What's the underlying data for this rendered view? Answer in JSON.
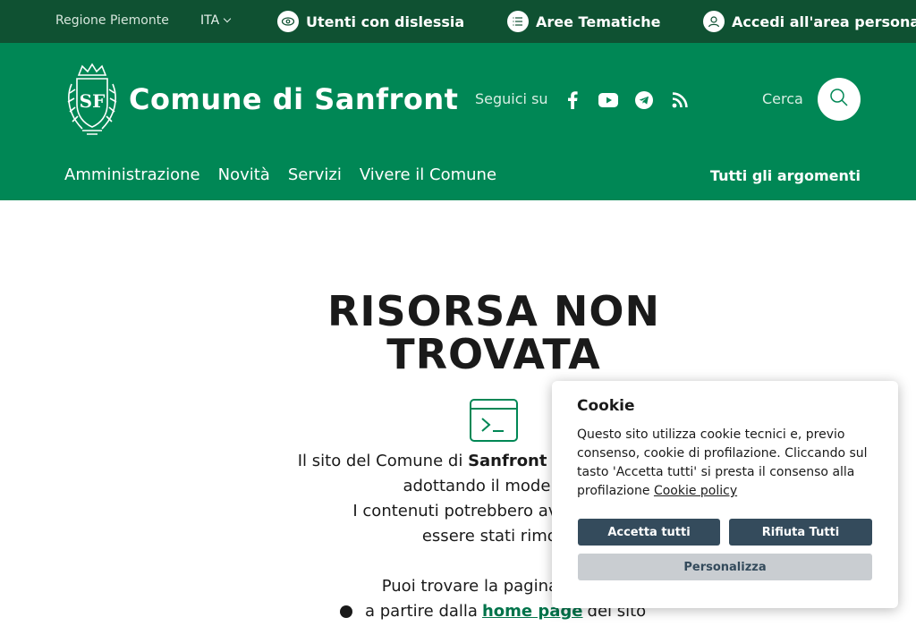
{
  "topbar": {
    "region": "Regione Piemonte",
    "language": "ITA",
    "links": {
      "dyslexia": "Utenti con dislessia",
      "areas": "Aree Tematiche",
      "login": "Accedi all'area personale"
    }
  },
  "header": {
    "site_title": "Comune di Sanfront",
    "logo_letters": "SF",
    "follow_label": "Seguici su",
    "search_label": "Cerca",
    "nav": [
      "Amministrazione",
      "Novità",
      "Servizi",
      "Vivere il Comune"
    ],
    "all_topics": "Tutti gli argomenti"
  },
  "error": {
    "title": "RISORSA NON TROVATA",
    "p1_before": "Il sito del Comune di",
    "p1_bold": "Sanfront",
    "p1_after": "è stato rinnovato adottando il modello p",
    "p1_line2": "I contenuti potrebbero avere un nu",
    "p1_line3": "essere stati rimos",
    "p2": "Puoi trovare la pagina che s",
    "bullet_before": "a partire dalla",
    "bullet_link": "home page",
    "bullet_after": "del sito"
  },
  "cookie": {
    "title": "Cookie",
    "text": "Questo sito utilizza cookie tecnici e, previo consenso, cookie di profilazione. Cliccando sul tasto 'Accetta tutti' si presta il consenso alla profilazione",
    "policy_link": "Cookie policy",
    "accept_all": "Accetta tutti",
    "reject_all": "Rifiuta Tutti",
    "customize": "Personalizza"
  },
  "colors": {
    "topbar_bg": "#0f5132",
    "header_bg": "#008755",
    "link_green": "#00734a",
    "button_dark": "#344b5c",
    "button_light": "#c9cdd1"
  }
}
